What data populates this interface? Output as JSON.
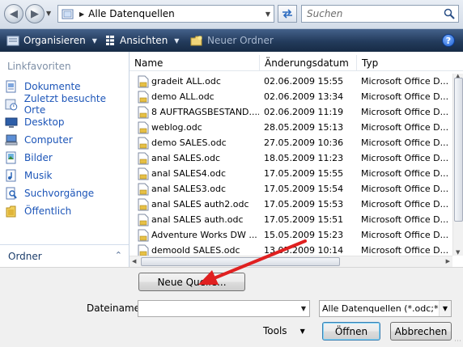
{
  "address": {
    "breadcrumb": "Alle Datenquellen",
    "search_placeholder": "Suchen"
  },
  "toolbar": {
    "organize": "Organisieren",
    "views": "Ansichten",
    "new_folder": "Neuer Ordner"
  },
  "sidebar": {
    "heading": "Linkfavoriten",
    "items": [
      {
        "label": "Dokumente",
        "icon": "documents-icon"
      },
      {
        "label": "Zuletzt besuchte Orte",
        "icon": "recent-places-icon"
      },
      {
        "label": "Desktop",
        "icon": "desktop-icon"
      },
      {
        "label": "Computer",
        "icon": "computer-icon"
      },
      {
        "label": "Bilder",
        "icon": "pictures-icon"
      },
      {
        "label": "Musik",
        "icon": "music-icon"
      },
      {
        "label": "Suchvorgänge",
        "icon": "searches-icon"
      },
      {
        "label": "Öffentlich",
        "icon": "public-folder-icon"
      }
    ],
    "folders_label": "Ordner"
  },
  "filelist": {
    "columns": [
      "Name",
      "Änderungsdatum",
      "Typ"
    ],
    "rows": [
      {
        "name": "gradeit ALL.odc",
        "date": "02.06.2009 15:55",
        "type": "Microsoft Office D..."
      },
      {
        "name": "demo ALL.odc",
        "date": "02.06.2009 13:34",
        "type": "Microsoft Office D..."
      },
      {
        "name": "8 AUFTRAGSBESTAND....",
        "date": "02.06.2009 11:19",
        "type": "Microsoft Office D..."
      },
      {
        "name": "weblog.odc",
        "date": "28.05.2009 15:13",
        "type": "Microsoft Office D..."
      },
      {
        "name": "demo SALES.odc",
        "date": "27.05.2009 10:36",
        "type": "Microsoft Office D..."
      },
      {
        "name": "anal SALES.odc",
        "date": "18.05.2009 11:23",
        "type": "Microsoft Office D..."
      },
      {
        "name": "anal SALES4.odc",
        "date": "17.05.2009 15:55",
        "type": "Microsoft Office D..."
      },
      {
        "name": "anal SALES3.odc",
        "date": "17.05.2009 15:54",
        "type": "Microsoft Office D..."
      },
      {
        "name": "anal SALES auth2.odc",
        "date": "17.05.2009 15:53",
        "type": "Microsoft Office D..."
      },
      {
        "name": "anal SALES auth.odc",
        "date": "17.05.2009 15:51",
        "type": "Microsoft Office D..."
      },
      {
        "name": "Adventure Works DW ...",
        "date": "15.05.2009 15:23",
        "type": "Microsoft Office D..."
      },
      {
        "name": "demoold SALES.odc",
        "date": "13.05.2009 10:14",
        "type": "Microsoft Office D..."
      }
    ]
  },
  "bottom": {
    "new_source": "Neue Quelle...",
    "filename_label": "Dateiname:",
    "filename_value": "",
    "filter": "Alle Datenquellen (*.odc;*.mdb",
    "tools": "Tools",
    "open": "Öffnen",
    "cancel": "Abbrechen"
  },
  "colors": {
    "toolbar_bg": "#233b5c",
    "link": "#1c55b8",
    "annotation_arrow": "#e02020"
  }
}
